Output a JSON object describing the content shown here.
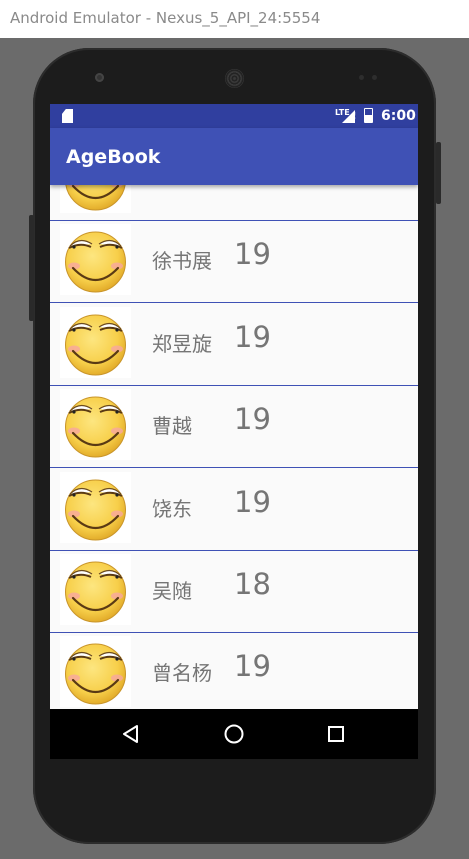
{
  "window": {
    "title": "Android Emulator - Nexus_5_API_24:5554"
  },
  "status_bar": {
    "time": "6:00",
    "network": "LTE",
    "alert": "!",
    "icons": [
      "sd-card-icon",
      "signal-icon",
      "battery-icon"
    ]
  },
  "app_bar": {
    "title": "AgeBook"
  },
  "list": {
    "items": [
      {
        "name": "",
        "age": "",
        "avatar": "smiley-icon"
      },
      {
        "name": "徐书展",
        "age": "19",
        "avatar": "smiley-icon"
      },
      {
        "name": "郑昱旋",
        "age": "19",
        "avatar": "smiley-icon"
      },
      {
        "name": "曹越",
        "age": "19",
        "avatar": "smiley-icon"
      },
      {
        "name": "饶东",
        "age": "19",
        "avatar": "smiley-icon"
      },
      {
        "name": "吴随",
        "age": "18",
        "avatar": "smiley-icon"
      },
      {
        "name": "曾名杨",
        "age": "19",
        "avatar": "smiley-icon"
      }
    ]
  },
  "nav_bar": {
    "buttons": [
      "back-icon",
      "home-icon",
      "recents-icon"
    ]
  },
  "colors": {
    "status_bar": "#303f9f",
    "app_bar": "#3f51b5",
    "divider": "#3f51b5",
    "text": "#757575"
  }
}
